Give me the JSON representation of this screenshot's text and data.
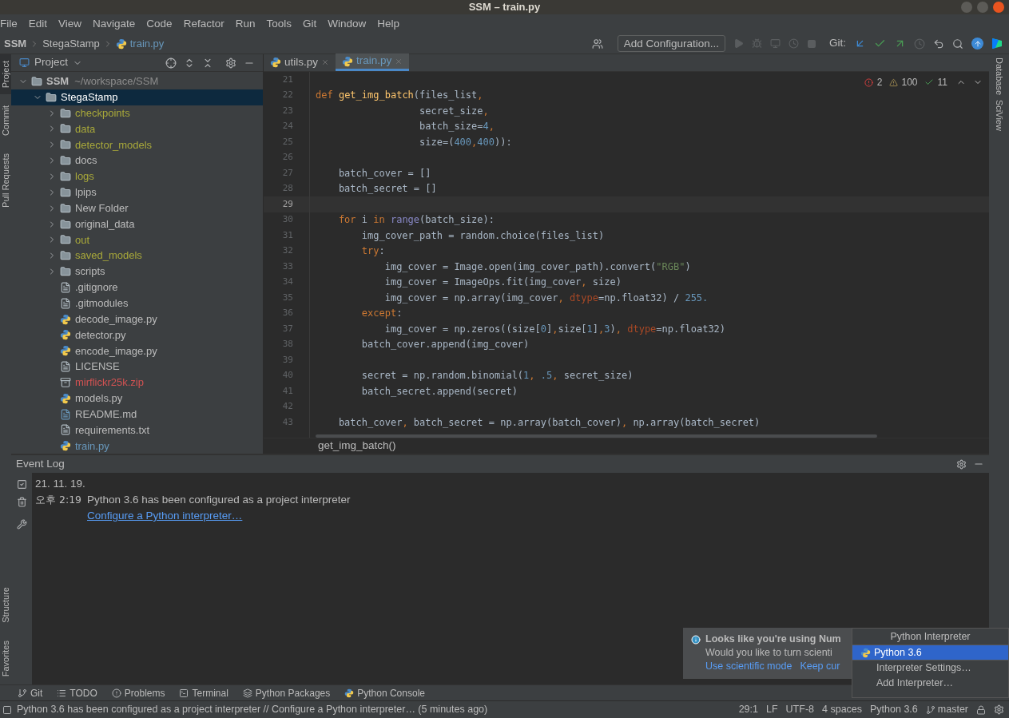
{
  "window": {
    "title": "SSM – train.py"
  },
  "menu": [
    "File",
    "Edit",
    "View",
    "Navigate",
    "Code",
    "Refactor",
    "Run",
    "Tools",
    "Git",
    "Window",
    "Help"
  ],
  "breadcrumb": [
    "SSM",
    "StegaStamp",
    "train.py"
  ],
  "toolbar": {
    "run_config": "Add Configuration...",
    "git_label": "Git:"
  },
  "left_strip": [
    {
      "label": "Project",
      "selected": true
    },
    {
      "label": "Commit",
      "selected": false
    },
    {
      "label": "Pull Requests",
      "selected": false
    }
  ],
  "left_strip_bottom": [
    {
      "label": "Structure",
      "selected": false
    },
    {
      "label": "Favorites",
      "selected": false
    }
  ],
  "right_strip": [
    {
      "label": "Database"
    },
    {
      "label": "SciView"
    }
  ],
  "project": {
    "title": "Project",
    "tree": [
      {
        "name": "SSM",
        "path": "~/workspace/SSM",
        "kind": "folder",
        "expanded": true,
        "selected": false,
        "color": "#bbbbbb",
        "children": [
          {
            "name": "StegaStamp",
            "kind": "folder",
            "expanded": true,
            "selected": true,
            "children": [
              {
                "name": "checkpoints",
                "kind": "folder",
                "expanded": false,
                "selected": false,
                "color": "#a8a83a"
              },
              {
                "name": "data",
                "kind": "folder",
                "expanded": false,
                "selected": false,
                "color": "#a8a83a"
              },
              {
                "name": "detector_models",
                "kind": "folder",
                "expanded": false,
                "selected": false,
                "color": "#a8a83a"
              },
              {
                "name": "docs",
                "kind": "folder",
                "expanded": false,
                "selected": false,
                "color": "#bbbbbb"
              },
              {
                "name": "logs",
                "kind": "folder",
                "expanded": false,
                "selected": false,
                "color": "#a8a83a"
              },
              {
                "name": "lpips",
                "kind": "folder",
                "expanded": false,
                "selected": false,
                "color": "#bbbbbb"
              },
              {
                "name": "New Folder",
                "kind": "folder",
                "expanded": false,
                "selected": false,
                "color": "#bbbbbb"
              },
              {
                "name": "original_data",
                "kind": "folder",
                "expanded": false,
                "selected": false,
                "color": "#bbbbbb"
              },
              {
                "name": "out",
                "kind": "folder",
                "expanded": false,
                "selected": false,
                "color": "#a8a83a"
              },
              {
                "name": "saved_models",
                "kind": "folder",
                "expanded": false,
                "selected": false,
                "color": "#a8a83a"
              },
              {
                "name": "scripts",
                "kind": "folder",
                "expanded": false,
                "selected": false,
                "color": "#bbbbbb"
              },
              {
                "name": ".gitignore",
                "kind": "text",
                "selected": false,
                "color": "#bbbbbb"
              },
              {
                "name": ".gitmodules",
                "kind": "text",
                "selected": false,
                "color": "#bbbbbb"
              },
              {
                "name": "decode_image.py",
                "kind": "py",
                "selected": false,
                "color": "#bbbbbb"
              },
              {
                "name": "detector.py",
                "kind": "py",
                "selected": false,
                "color": "#bbbbbb"
              },
              {
                "name": "encode_image.py",
                "kind": "py",
                "selected": false,
                "color": "#bbbbbb"
              },
              {
                "name": "LICENSE",
                "kind": "text",
                "selected": false,
                "color": "#bbbbbb"
              },
              {
                "name": "mirflickr25k.zip",
                "kind": "zip",
                "selected": false,
                "color": "#d25252"
              },
              {
                "name": "models.py",
                "kind": "py",
                "selected": false,
                "color": "#bbbbbb"
              },
              {
                "name": "README.md",
                "kind": "md",
                "selected": false,
                "color": "#bbbbbb"
              },
              {
                "name": "requirements.txt",
                "kind": "text",
                "selected": false,
                "color": "#bbbbbb"
              },
              {
                "name": "train.py",
                "kind": "py",
                "selected": false,
                "color": "#6897bb"
              }
            ]
          }
        ]
      }
    ]
  },
  "tabs": [
    {
      "label": "utils.py",
      "selected": false
    },
    {
      "label": "train.py",
      "selected": true
    }
  ],
  "inspections": {
    "errors": "2",
    "warnings": "100",
    "weak": "11"
  },
  "code": [
    {
      "n": "21",
      "current": false
    },
    {
      "n": "22",
      "current": false,
      "tokens": [
        {
          "t": "def",
          "kind": "keyword"
        },
        {
          "t": " get_img_batch",
          "kind": "function"
        },
        {
          "t": "(files_list",
          "kind": "plain"
        },
        {
          "t": ",",
          "kind": "keyword"
        }
      ]
    },
    {
      "n": "23",
      "current": false,
      "tokens": [
        {
          "t": "                  secret_size",
          "kind": "plain"
        },
        {
          "t": ",",
          "kind": "keyword"
        }
      ]
    },
    {
      "n": "24",
      "current": false,
      "tokens": [
        {
          "t": "                  batch_size=",
          "kind": "plain"
        },
        {
          "t": "4",
          "kind": "number"
        },
        {
          "t": ",",
          "kind": "keyword"
        }
      ]
    },
    {
      "n": "25",
      "current": false,
      "tokens": [
        {
          "t": "                  size=(",
          "kind": "plain"
        },
        {
          "t": "400",
          "kind": "number"
        },
        {
          "t": ",",
          "kind": "keyword"
        },
        {
          "t": "400",
          "kind": "number"
        },
        {
          "t": ")):",
          "kind": "plain"
        }
      ]
    },
    {
      "n": "26",
      "current": false
    },
    {
      "n": "27",
      "current": false,
      "tokens": [
        {
          "t": "    batch_cover = []",
          "kind": "plain"
        }
      ]
    },
    {
      "n": "28",
      "current": false,
      "tokens": [
        {
          "t": "    batch_secret = []",
          "kind": "plain"
        }
      ]
    },
    {
      "n": "29",
      "current": true
    },
    {
      "n": "30",
      "current": false,
      "tokens": [
        {
          "t": "    for",
          "kind": "keyword"
        },
        {
          "t": " i ",
          "kind": "plain"
        },
        {
          "t": "in",
          "kind": "keyword"
        },
        {
          "t": " range",
          "kind": "builtin"
        },
        {
          "t": "(batch_size):",
          "kind": "plain"
        }
      ]
    },
    {
      "n": "31",
      "current": false,
      "tokens": [
        {
          "t": "        img_cover_path = random.choice(files_list)",
          "kind": "plain"
        }
      ]
    },
    {
      "n": "32",
      "current": false,
      "tokens": [
        {
          "t": "        try",
          "kind": "keyword"
        },
        {
          "t": ":",
          "kind": "plain"
        }
      ]
    },
    {
      "n": "33",
      "current": false,
      "tokens": [
        {
          "t": "            img_cover = Image.open(img_cover_path).convert(",
          "kind": "plain"
        },
        {
          "t": "\"RGB\"",
          "kind": "string"
        },
        {
          "t": ")",
          "kind": "plain"
        }
      ]
    },
    {
      "n": "34",
      "current": false,
      "tokens": [
        {
          "t": "            img_cover = ImageOps.fit(img_cover",
          "kind": "plain"
        },
        {
          "t": ",",
          "kind": "keyword"
        },
        {
          "t": " size)",
          "kind": "plain"
        }
      ]
    },
    {
      "n": "35",
      "current": false,
      "tokens": [
        {
          "t": "            img_cover = np.array(img_cover",
          "kind": "plain"
        },
        {
          "t": ",",
          "kind": "keyword"
        },
        {
          "t": " dtype",
          "kind": "argument"
        },
        {
          "t": "=np.float32) / ",
          "kind": "plain"
        },
        {
          "t": "255.",
          "kind": "number"
        }
      ]
    },
    {
      "n": "36",
      "current": false,
      "tokens": [
        {
          "t": "        except",
          "kind": "keyword"
        },
        {
          "t": ":",
          "kind": "plain"
        }
      ]
    },
    {
      "n": "37",
      "current": false,
      "tokens": [
        {
          "t": "            img_cover = np.zeros((size[",
          "kind": "plain"
        },
        {
          "t": "0",
          "kind": "number"
        },
        {
          "t": "]",
          "kind": "plain"
        },
        {
          "t": ",",
          "kind": "keyword"
        },
        {
          "t": "size[",
          "kind": "plain"
        },
        {
          "t": "1",
          "kind": "number"
        },
        {
          "t": "]",
          "kind": "plain"
        },
        {
          "t": ",",
          "kind": "keyword"
        },
        {
          "t": "3",
          "kind": "number"
        },
        {
          "t": ")",
          "kind": "plain"
        },
        {
          "t": ",",
          "kind": "keyword"
        },
        {
          "t": " dtype",
          "kind": "argument"
        },
        {
          "t": "=np.float32)",
          "kind": "plain"
        }
      ]
    },
    {
      "n": "38",
      "current": false,
      "tokens": [
        {
          "t": "        batch_cover.append(img_cover)",
          "kind": "plain"
        }
      ]
    },
    {
      "n": "39",
      "current": false
    },
    {
      "n": "40",
      "current": false,
      "tokens": [
        {
          "t": "        secret = np.random.binomial(",
          "kind": "plain"
        },
        {
          "t": "1",
          "kind": "number"
        },
        {
          "t": ",",
          "kind": "keyword"
        },
        {
          "t": " .5",
          "kind": "number"
        },
        {
          "t": ",",
          "kind": "keyword"
        },
        {
          "t": " secret_size)",
          "kind": "plain"
        }
      ]
    },
    {
      "n": "41",
      "current": false,
      "tokens": [
        {
          "t": "        batch_secret.append(secret)",
          "kind": "plain"
        }
      ]
    },
    {
      "n": "42",
      "current": false
    },
    {
      "n": "43",
      "current": false,
      "tokens": [
        {
          "t": "    batch_cover",
          "kind": "plain"
        },
        {
          "t": ",",
          "kind": "keyword"
        },
        {
          "t": " batch_secret = np.array(batch_cover)",
          "kind": "plain"
        },
        {
          "t": ",",
          "kind": "keyword"
        },
        {
          "t": " np.array(batch_secret)",
          "kind": "plain"
        }
      ]
    }
  ],
  "editor_breadcrumb": "get_img_batch()",
  "event_log": {
    "title": "Event Log",
    "date": "21. 11. 19.",
    "time": "오후 2:19",
    "message": "Python 3.6 has been configured as a project interpreter",
    "link": "Configure a Python interpreter…"
  },
  "notification": {
    "title": "Looks like you're using Num",
    "body": "Would you like to turn scienti",
    "actions": [
      "Use scientific mode",
      "Keep cur"
    ]
  },
  "interpreter_popup": {
    "title": "Python Interpreter",
    "items": [
      {
        "label": "Python 3.6",
        "kind": "interpreter",
        "selected": true
      },
      {
        "label": "Interpreter Settings…",
        "kind": "action",
        "selected": false
      },
      {
        "label": "Add Interpreter…",
        "kind": "action",
        "selected": false
      }
    ]
  },
  "tool_windows": [
    {
      "label": "Git",
      "kind": "git"
    },
    {
      "label": "TODO",
      "kind": "todo"
    },
    {
      "label": "Problems",
      "kind": "problems"
    },
    {
      "label": "Terminal",
      "kind": "terminal"
    },
    {
      "label": "Python Packages",
      "kind": "packages"
    },
    {
      "label": "Python Console",
      "kind": "console"
    }
  ],
  "status_bar": {
    "message": "Python 3.6 has been configured as a project interpreter // Configure a Python interpreter… (5 minutes ago)",
    "position": "29:1",
    "line_ending": "LF",
    "encoding": "UTF-8",
    "indent": "4 spaces",
    "interpreter": "Python 3.6",
    "branch": "master"
  }
}
